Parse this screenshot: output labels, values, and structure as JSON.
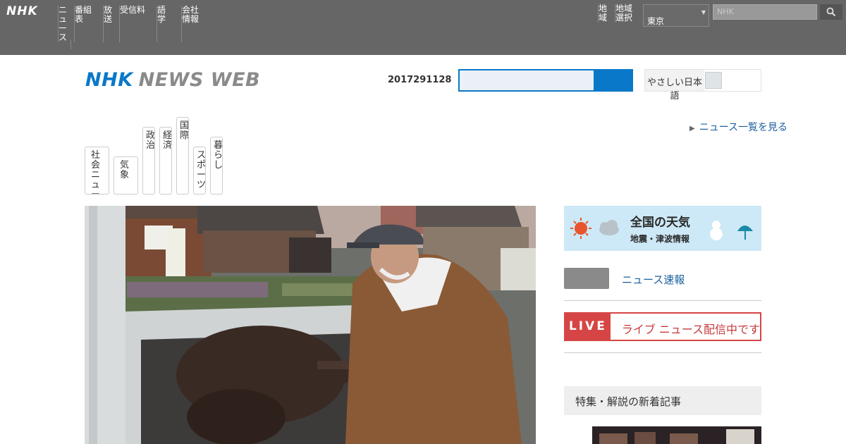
{
  "global_bar": {
    "logo": "NHK",
    "nav": [
      "ニュース",
      "番組表",
      "放送",
      "受信料",
      "語学",
      "会社情報"
    ],
    "right_items": [
      "地域",
      "地域選択"
    ],
    "region_select": "東京",
    "search_placeholder": "NHK"
  },
  "header": {
    "logo_nhk": "NHK",
    "logo_news_web": "NEWS WEB",
    "date": "2017291128",
    "toggle_label": "やさしい日本語"
  },
  "more_link": "ニュース一覧を見る",
  "tabs": [
    "社会ニュース",
    "気象",
    "政治",
    "経済",
    "国際",
    "スポーツ",
    "暮らし"
  ],
  "sidebar": {
    "weather_title": "全国の天気",
    "weather_sub": "地震・津波情報",
    "pill_link": "ニュース速報",
    "live_badge": "LIVE",
    "live_text": "ライブ ニュース配信中です",
    "section_head": "特集・解説の新着記事"
  },
  "colors": {
    "global_bar": "#666666",
    "accent_blue": "#0a78c8",
    "live_red": "#d64545"
  }
}
